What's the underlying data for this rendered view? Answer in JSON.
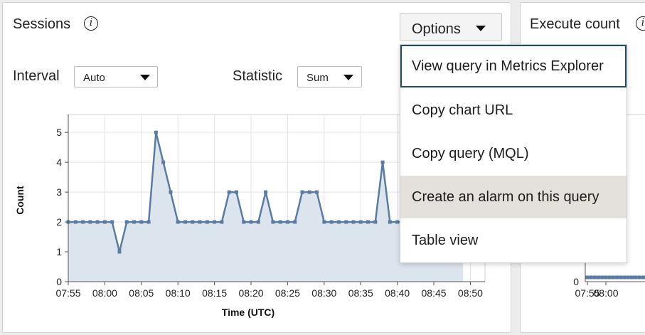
{
  "sessions_panel": {
    "title": "Sessions",
    "options_label": "Options",
    "interval_label": "Interval",
    "interval_value": "Auto",
    "statistic_label": "Statistic",
    "statistic_value": "Sum"
  },
  "execute_panel": {
    "title": "Execute count"
  },
  "options_menu": {
    "items": [
      {
        "label": "View query in Metrics Explorer"
      },
      {
        "label": "Copy chart URL"
      },
      {
        "label": "Copy query (MQL)"
      },
      {
        "label": "Create an alarm on this query"
      },
      {
        "label": "Table view"
      }
    ]
  },
  "colors": {
    "series": "#5a7ca3",
    "fill": "#dce4ee",
    "menu_focus": "#1f4e5c",
    "menu_hover": "#e4e1dd"
  },
  "chart_data": [
    {
      "type": "area",
      "xlabel": "Time (UTC)",
      "ylabel": "Count",
      "xlim": [
        "07:55",
        "08:52"
      ],
      "ylim": [
        0,
        5.6
      ],
      "grid": true,
      "x_ticks": [
        "07:55",
        "08:00",
        "08:05",
        "08:10",
        "08:15",
        "08:20",
        "08:25",
        "08:30",
        "08:35",
        "08:40",
        "08:45",
        "08:50"
      ],
      "y_ticks": [
        0,
        1,
        2,
        3,
        4,
        5
      ],
      "x_start": "07:55",
      "values": [
        2,
        2,
        2,
        2,
        2,
        2,
        2,
        1,
        2,
        2,
        2,
        2,
        5,
        4,
        3,
        2,
        2,
        2,
        2,
        2,
        2,
        2,
        3,
        3,
        2,
        2,
        2,
        3,
        2,
        2,
        2,
        2,
        3,
        3,
        3,
        2,
        2,
        2,
        2,
        2,
        2,
        2,
        2,
        4,
        2,
        2,
        2,
        2,
        2,
        2,
        2,
        2,
        2,
        2,
        2
      ]
    },
    {
      "type": "line",
      "y_ticks": [
        0
      ],
      "x_ticks": [
        "07:55",
        "08:00"
      ],
      "values": [
        0.1,
        0.1,
        0.1,
        0.1,
        0.1,
        0.1,
        0.1,
        0.1,
        0.1,
        0.1,
        0.1,
        0.1,
        0.1,
        0.1,
        0.1,
        0.1,
        0.1
      ]
    }
  ]
}
